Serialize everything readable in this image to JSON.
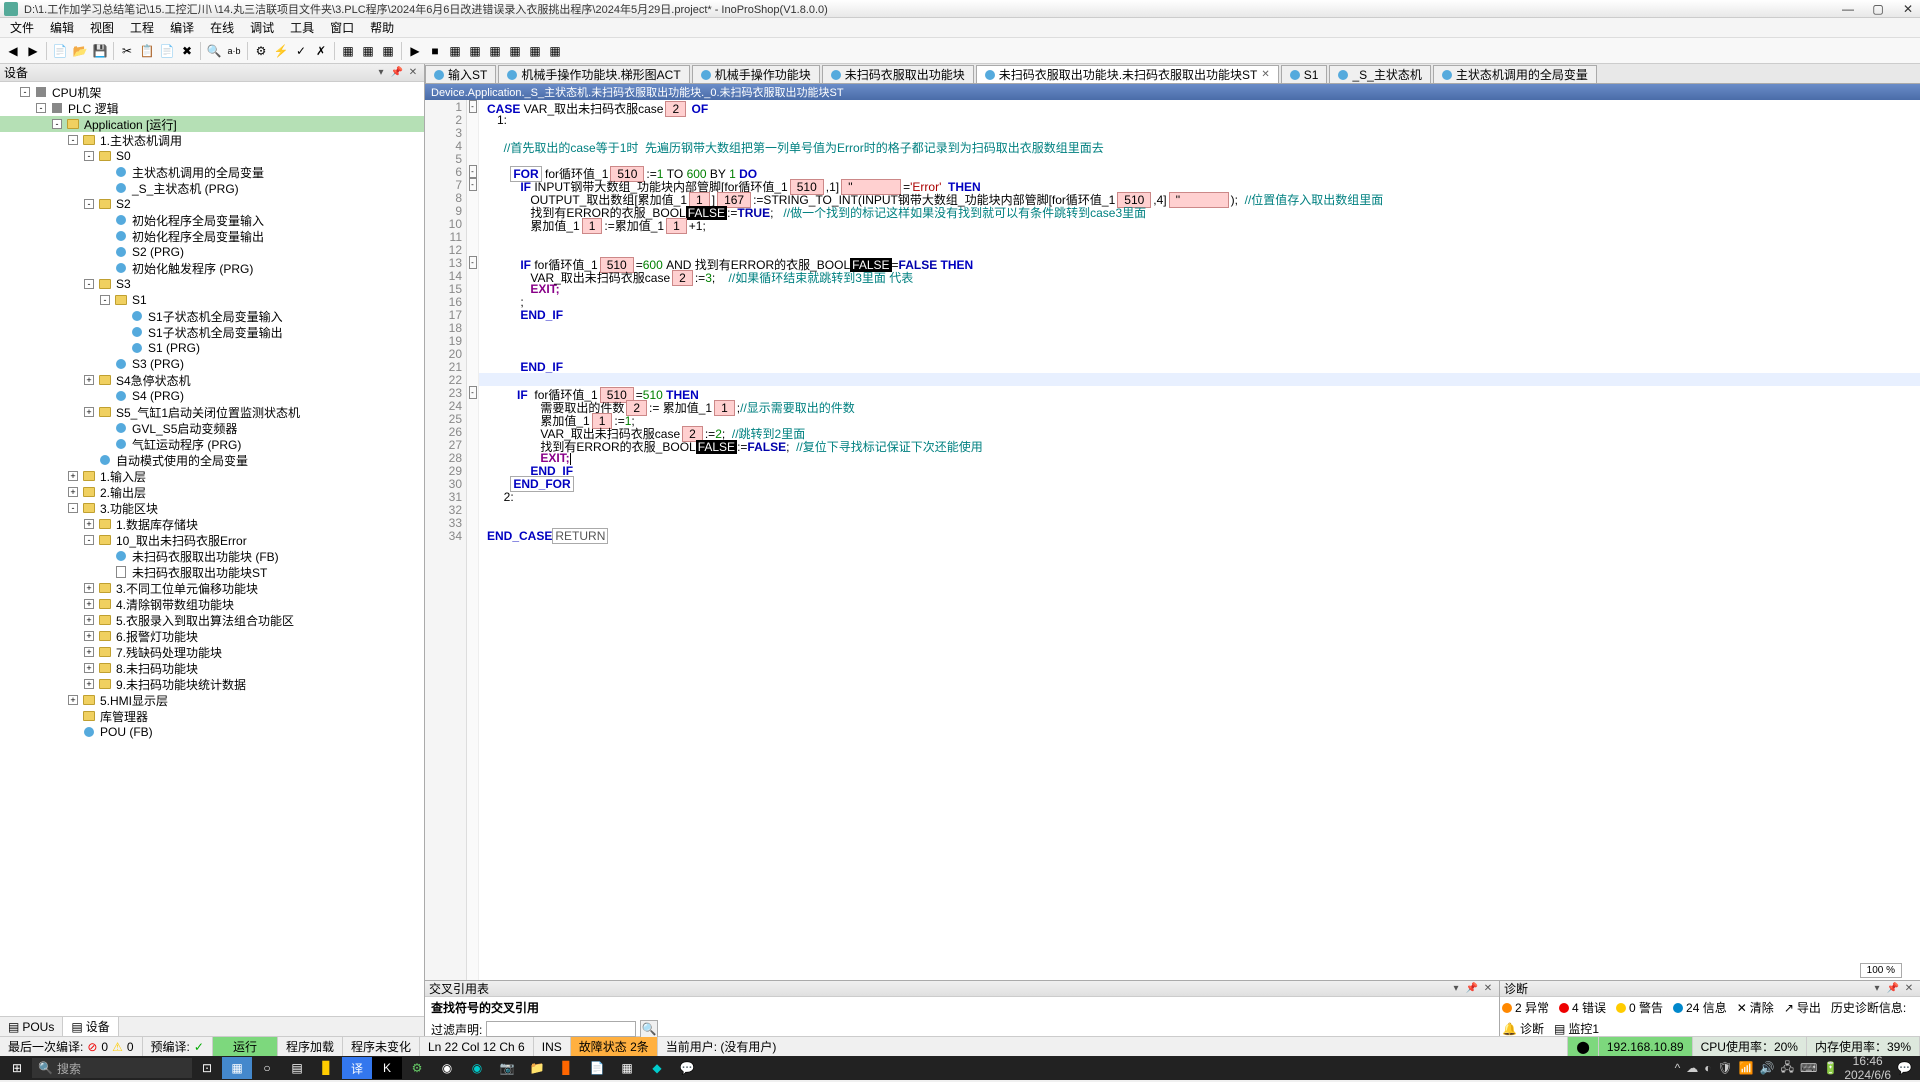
{
  "window": {
    "title": "D:\\1.工作加学习总结笔记\\15.工控汇川\\ \\14.丸三洁联项目文件夹\\3.PLC程序\\2024年6月6日改进错误录入衣服挑出程序\\2024年5月29日.project* - InoProShop(V1.8.0.0)"
  },
  "menu": [
    "文件",
    "编辑",
    "视图",
    "工程",
    "编译",
    "在线",
    "调试",
    "工具",
    "窗口",
    "帮助"
  ],
  "left_panel": {
    "title": "设备"
  },
  "left_tabs": {
    "pous": "POUs",
    "devices": "设备"
  },
  "tree": [
    {
      "label": "CPU机架",
      "indent": 20,
      "toggle": "-",
      "icon": "cpu"
    },
    {
      "label": "PLC 逻辑",
      "indent": 36,
      "toggle": "-",
      "icon": "cpu"
    },
    {
      "label": "Application [运行]",
      "indent": 52,
      "toggle": "-",
      "icon": "folder",
      "selected": true
    },
    {
      "label": "1.主状态机调用",
      "indent": 68,
      "toggle": "-",
      "icon": "folder"
    },
    {
      "label": "S0",
      "indent": 84,
      "toggle": "-",
      "icon": "folder"
    },
    {
      "label": "主状态机调用的全局变量",
      "indent": 100,
      "toggle": "",
      "icon": "gvl"
    },
    {
      "label": "_S_主状态机 (PRG)",
      "indent": 100,
      "toggle": "",
      "icon": "prg"
    },
    {
      "label": "S2",
      "indent": 84,
      "toggle": "-",
      "icon": "folder"
    },
    {
      "label": "初始化程序全局变量输入",
      "indent": 100,
      "toggle": "",
      "icon": "gvl"
    },
    {
      "label": "初始化程序全局变量输出",
      "indent": 100,
      "toggle": "",
      "icon": "gvl"
    },
    {
      "label": "S2 (PRG)",
      "indent": 100,
      "toggle": "",
      "icon": "prg"
    },
    {
      "label": "初始化触发程序 (PRG)",
      "indent": 100,
      "toggle": "",
      "icon": "prg"
    },
    {
      "label": "S3",
      "indent": 84,
      "toggle": "-",
      "icon": "folder"
    },
    {
      "label": "S1",
      "indent": 100,
      "toggle": "-",
      "icon": "folder"
    },
    {
      "label": "S1子状态机全局变量输入",
      "indent": 116,
      "toggle": "",
      "icon": "gvl"
    },
    {
      "label": "S1子状态机全局变量输出",
      "indent": 116,
      "toggle": "",
      "icon": "gvl"
    },
    {
      "label": "S1 (PRG)",
      "indent": 116,
      "toggle": "",
      "icon": "prg"
    },
    {
      "label": "S3 (PRG)",
      "indent": 100,
      "toggle": "",
      "icon": "prg"
    },
    {
      "label": "S4急停状态机",
      "indent": 84,
      "toggle": "+",
      "icon": "folder"
    },
    {
      "label": "S4 (PRG)",
      "indent": 100,
      "toggle": "",
      "icon": "prg"
    },
    {
      "label": "S5_气缸1启动关闭位置监测状态机",
      "indent": 84,
      "toggle": "+",
      "icon": "folder"
    },
    {
      "label": "GVL_S5启动变频器",
      "indent": 100,
      "toggle": "",
      "icon": "gvl"
    },
    {
      "label": "气缸运动程序 (PRG)",
      "indent": 100,
      "toggle": "",
      "icon": "prg"
    },
    {
      "label": "自动模式使用的全局变量",
      "indent": 84,
      "toggle": "",
      "icon": "gvl"
    },
    {
      "label": "1.输入层",
      "indent": 68,
      "toggle": "+",
      "icon": "folder"
    },
    {
      "label": "2.输出层",
      "indent": 68,
      "toggle": "+",
      "icon": "folder"
    },
    {
      "label": "3.功能区块",
      "indent": 68,
      "toggle": "-",
      "icon": "folder"
    },
    {
      "label": "1.数据库存储块",
      "indent": 84,
      "toggle": "+",
      "icon": "folder"
    },
    {
      "label": "10_取出未扫码衣服Error",
      "indent": 84,
      "toggle": "-",
      "icon": "folder"
    },
    {
      "label": "未扫码衣服取出功能块 (FB)",
      "indent": 100,
      "toggle": "",
      "icon": "prg"
    },
    {
      "label": "未扫码衣服取出功能块ST",
      "indent": 100,
      "toggle": "",
      "icon": "file-st"
    },
    {
      "label": "3.不同工位单元偏移功能块",
      "indent": 84,
      "toggle": "+",
      "icon": "folder"
    },
    {
      "label": "4.清除钢带数组功能块",
      "indent": 84,
      "toggle": "+",
      "icon": "folder"
    },
    {
      "label": "5.衣服录入到取出算法组合功能区",
      "indent": 84,
      "toggle": "+",
      "icon": "folder"
    },
    {
      "label": "6.报警灯功能块",
      "indent": 84,
      "toggle": "+",
      "icon": "folder"
    },
    {
      "label": "7.残缺码处理功能块",
      "indent": 84,
      "toggle": "+",
      "icon": "folder"
    },
    {
      "label": "8.未扫码功能块",
      "indent": 84,
      "toggle": "+",
      "icon": "folder"
    },
    {
      "label": "9.未扫码功能块统计数据",
      "indent": 84,
      "toggle": "+",
      "icon": "folder"
    },
    {
      "label": "5.HMI显示层",
      "indent": 68,
      "toggle": "+",
      "icon": "folder"
    },
    {
      "label": "库管理器",
      "indent": 68,
      "toggle": "",
      "icon": "folder"
    },
    {
      "label": "POU (FB)",
      "indent": 68,
      "toggle": "",
      "icon": "prg"
    }
  ],
  "editor_tabs": [
    {
      "label": "输入ST",
      "active": false,
      "icon": "#5ad"
    },
    {
      "label": "机械手操作功能块.梯形图ACT",
      "active": false,
      "icon": "#5ad"
    },
    {
      "label": "机械手操作功能块",
      "active": false,
      "icon": "#5ad"
    },
    {
      "label": "未扫码衣服取出功能块",
      "active": false,
      "icon": "#5ad"
    },
    {
      "label": "未扫码衣服取出功能块.未扫码衣服取出功能块ST",
      "active": true,
      "icon": "#5ad",
      "closable": true
    },
    {
      "label": "S1",
      "active": false,
      "icon": "#5ad"
    },
    {
      "label": "_S_主状态机",
      "active": false,
      "icon": "#5ad"
    },
    {
      "label": "主状态机调用的全局变量",
      "active": false,
      "icon": "#5ad"
    }
  ],
  "breadcrumb": "Device.Application._S_主状态机.未扫码衣服取出功能块._0.未扫码衣服取出功能块ST",
  "code": {
    "l1_a": "CASE",
    "l1_b": " VAR_取出未扫码衣服case",
    "l1_v": "2",
    "l1_c": " OF",
    "l2": "1:",
    "l3": "//首先取出的case等于1时  先遍历钢带大数组把第一列单号值为Error时的格子都记录到为扫码取出衣服数组里面去",
    "l6_a": "FOR",
    "l6_b": " for循环值_1",
    "l6_v": "510",
    "l6_c": ":=",
    "l6_d": "1",
    "l6_e": " TO ",
    "l6_f": "600",
    "l6_g": " BY ",
    "l6_h": "1",
    "l6_i": " DO",
    "l7_a": "IF",
    "l7_b": " INPUT钢带大数组_功能块内部管脚[for循环值_1",
    "l7_v": "510",
    "l7_c": ",1]",
    "l7_empty": "''",
    "l7_d": "=",
    "l7_e": "'Error'",
    "l7_f": "  THEN",
    "l8_a": "OUTPUT_取出数组[累加值_1",
    "l8_v1": "1",
    "l8_b": "]",
    "l8_v2": "167",
    "l8_c": ":=STRING_TO_INT(INPUT钢带大数组_功能块内部管脚[for循环值_1",
    "l8_v3": "510",
    "l8_d": ",4]",
    "l8_empty": "''",
    "l8_e": ");  ",
    "l8_cmt": "//位置值存入取出数组里面",
    "l9_a": "找到有ERROR的衣服_BOOL",
    "l9_v": "FALSE",
    "l9_b": ":=",
    "l9_c": "TRUE",
    "l9_d": ";   ",
    "l9_cmt": "//做一个找到的标记这样如果没有找到就可以有条件跳转到case3里面",
    "l10_a": "累加值_1",
    "l10_v1": "1",
    "l10_b": ":=累加值_1",
    "l10_v2": "1",
    "l10_c": "+1;",
    "l13_a": "IF",
    "l13_b": " for循环值_1",
    "l13_v": "510",
    "l13_c": "=",
    "l13_d": "600",
    "l13_e": " AND 找到有ERROR的衣服_BOOL",
    "l13_v2": "FALSE",
    "l13_f": "=",
    "l13_g": "FALSE",
    "l13_h": " THEN",
    "l14_a": "VAR_取出未扫码衣服case",
    "l14_v": "2",
    "l14_b": ":=",
    "l14_c": "3",
    "l14_d": ";    ",
    "l14_cmt": "//如果循环结束就跳转到3里面 代表",
    "l15": "EXIT;",
    "l16": ";",
    "l17": "END_IF",
    "l21": "END_IF",
    "l23_a": "IF",
    "l23_b": "  for循环值_1",
    "l23_v": "510",
    "l23_c": "=",
    "l23_d": "510",
    "l23_e": " THEN",
    "l24_a": "需要取出的件数",
    "l24_v": "2",
    "l24_b": ":= 累加值_1",
    "l24_v2": "1",
    "l24_c": ";",
    "l24_cmt": "//显示需要取出的件数",
    "l25_a": "累加值_1",
    "l25_v": "1",
    "l25_b": ":=",
    "l25_c": "1",
    "l25_d": ";",
    "l26_a": "VAR_取出未扫码衣服case",
    "l26_v": "2",
    "l26_b": ":=",
    "l26_c": "2",
    "l26_d": ";  ",
    "l26_cmt": "//跳转到2里面",
    "l27_a": "找到有ERROR的衣服_BOOL",
    "l27_v": "FALSE",
    "l27_b": ":=",
    "l27_c": "FALSE",
    "l27_d": ";  ",
    "l27_cmt": "//复位下寻找标记保证下次还能使用",
    "l28": "EXIT;",
    "l29": "END_IF",
    "l30": "END_FOR",
    "l31": "2:",
    "l34_a": "END_CASE",
    "l34_b": "RETURN"
  },
  "fold": {
    "1": "-",
    "6": "-",
    "7": "-",
    "13": "-",
    "23": "-"
  },
  "cross_ref": {
    "title": "交叉引用表",
    "search_label": "查找符号的交叉引用",
    "filter_label": "过滤声明:"
  },
  "diag": {
    "title": "诊断",
    "abnormal": "2 异常",
    "errors": "4 错误",
    "warnings": "0 警告",
    "info": "24 信息",
    "clear": "清除",
    "export": "导出",
    "history": "历史诊断信息:",
    "diag_btn": "诊断",
    "monitor": "监控1"
  },
  "status": {
    "last_compile": "最后一次编译:",
    "ok": "0",
    "warn": "0",
    "err": "0",
    "precompile": "预编译:",
    "run": "运行",
    "loaded": "程序加载",
    "unchanged": "程序未变化",
    "pos": "Ln 22    Col 12    Ch 6",
    "ins": "INS",
    "fault": "故障状态 2条",
    "user": "当前用户: (没有用户)",
    "ip": "192.168.10.89",
    "cpu": "CPU使用率：20%",
    "mem": "内存使用率：39%"
  },
  "zoom": "100 %",
  "taskbar": {
    "search": "搜索",
    "time": "16:46",
    "date": "2024/6/6"
  }
}
